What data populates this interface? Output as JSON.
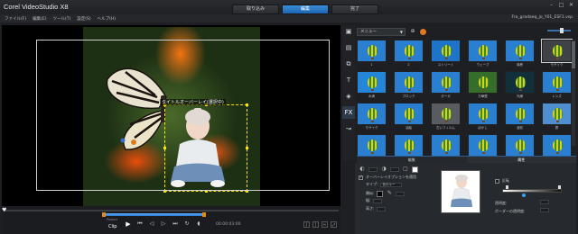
{
  "app": {
    "title": "Corel VideoStudio X8",
    "steps": [
      {
        "label": "取り込み",
        "active": false
      },
      {
        "label": "編集",
        "active": true
      },
      {
        "label": "完了",
        "active": false
      }
    ],
    "project_name": "Fra_gradaeq_jo_Y01_ESF1.vsp"
  },
  "menu": [
    "ファイル(F)",
    "編集(E)",
    "ツール(T)",
    "設定(S)",
    "ヘルプ(H)"
  ],
  "preview": {
    "title_overlay": "タイトルオーバーレイ(選択中)",
    "mode_labels": [
      "Project",
      "Clip"
    ],
    "timecode": "00:00:03:00"
  },
  "library": {
    "category": "メニュー",
    "tabs": [
      {
        "icon": "media-icon",
        "glyph": "▣"
      },
      {
        "icon": "instant-project-icon",
        "glyph": "▤"
      },
      {
        "icon": "transition-icon",
        "glyph": "⧉"
      },
      {
        "icon": "title-icon",
        "glyph": "T"
      },
      {
        "icon": "graphics-icon",
        "glyph": "◈"
      },
      {
        "icon": "fx-icon",
        "glyph": "FX"
      },
      {
        "icon": "path-icon",
        "glyph": "↝"
      }
    ],
    "items": [
      {
        "label": "1",
        "bg": "#2a7fd0",
        "selected": false
      },
      {
        "label": "2",
        "bg": "#2a7fd0",
        "selected": false
      },
      {
        "label": "ストリート",
        "bg": "#1e74c8",
        "selected": false
      },
      {
        "label": "ウェーブ",
        "bg": "#2a7fd0",
        "selected": false
      },
      {
        "label": "渦巻",
        "bg": "#2a7fd0",
        "selected": false
      },
      {
        "label": "モザイク",
        "bg": "#3f4246",
        "selected": true
      },
      {
        "label": "水滴",
        "bg": "#2486d8",
        "selected": false
      },
      {
        "label": "ブロック",
        "bg": "#2a7fd0",
        "selected": false
      },
      {
        "label": "ガーガ",
        "bg": "#2a7fd0",
        "selected": false
      },
      {
        "label": "万華鏡",
        "bg": "#356e2a",
        "selected": false
      },
      {
        "label": "光線",
        "bg": "#12303c",
        "selected": false
      },
      {
        "label": "レンズ",
        "bg": "#2a7fd0",
        "selected": false
      },
      {
        "label": "モザイク",
        "bg": "#2a7fd0",
        "selected": false
      },
      {
        "label": "油絵",
        "bg": "#2a7fd0",
        "selected": false
      },
      {
        "label": "古いフィルム",
        "bg": "#585b5f",
        "selected": false
      },
      {
        "label": "ぼかし",
        "bg": "#2a7fd0",
        "selected": false
      },
      {
        "label": "波紋",
        "bg": "#2a7fd0",
        "selected": false
      },
      {
        "label": "霧",
        "bg": "#4f8fcf",
        "selected": false
      },
      {
        "label": "",
        "bg": "#2a7fd0",
        "selected": false
      },
      {
        "label": "",
        "bg": "#2a7fd0",
        "selected": false
      },
      {
        "label": "",
        "bg": "#2a7fd0",
        "selected": false
      },
      {
        "label": "",
        "bg": "#2a7fd0",
        "selected": false
      },
      {
        "label": "",
        "bg": "#2a7fd0",
        "selected": false
      },
      {
        "label": "",
        "bg": "#2a7fd0",
        "selected": false
      }
    ]
  },
  "options": {
    "tabs": [
      {
        "label": "編集",
        "active": false
      },
      {
        "label": "属性",
        "active": true
      }
    ],
    "mask_checkbox": "オーバーレイオプションを適用",
    "type_label": "タイプ:",
    "type_value": "色のキー",
    "similarity_label": "類似:",
    "width_label": "幅:",
    "height_label": "高さ:",
    "invert_label": "反転",
    "transparency_label": "透明度:",
    "border_label": "ボーダーの透明度:",
    "colors": {
      "accent": "#2b78d0",
      "key_color": "#000000",
      "white": "#ffffff"
    }
  }
}
